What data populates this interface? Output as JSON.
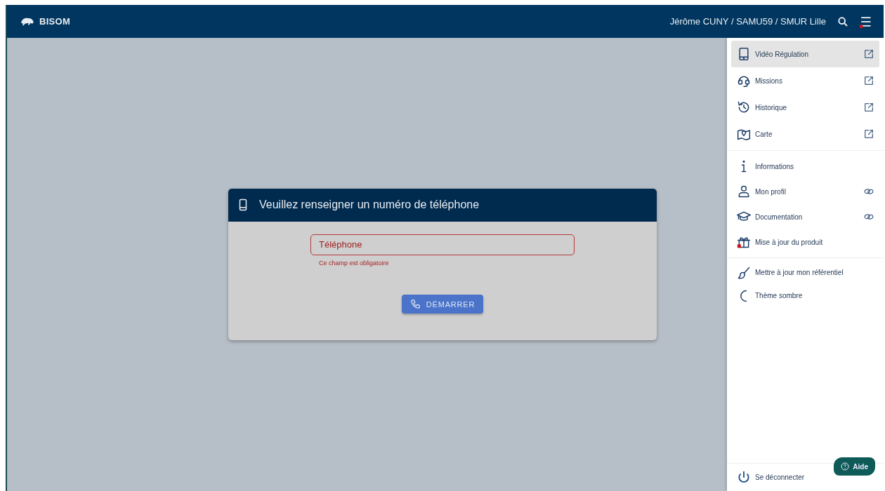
{
  "header": {
    "brand": "BISOM",
    "user": "Jérôme CUNY / SAMU59 / SMUR Lille",
    "menu_notification": true
  },
  "dialog": {
    "title": "Veuillez renseigner un numéro de téléphone",
    "field": {
      "placeholder": "Téléphone",
      "invalid": true,
      "error": "Ce champ est obligatoire"
    },
    "start_button": {
      "label": "DÉMARRER"
    }
  },
  "menu": {
    "groups": [
      {
        "items": [
          {
            "label": "Vidéo Régulation",
            "kind": "external",
            "selected": true,
            "notification": false
          },
          {
            "label": "Missions",
            "kind": "external",
            "selected": false,
            "notification": false
          },
          {
            "label": "Historique",
            "kind": "external",
            "selected": false,
            "notification": false
          },
          {
            "label": "Carte",
            "kind": "external",
            "selected": false,
            "notification": false
          }
        ]
      },
      {
        "items": [
          {
            "label": "Informations",
            "kind": "plain",
            "selected": false,
            "notification": false
          },
          {
            "label": "Mon profil",
            "kind": "link",
            "selected": false,
            "notification": false
          },
          {
            "label": "Documentation",
            "kind": "link",
            "selected": false,
            "notification": false
          },
          {
            "label": "Mise à jour du produit",
            "kind": "plain",
            "selected": false,
            "notification": true
          }
        ]
      },
      {
        "items": [
          {
            "label": "Mettre à jour mon référentiel",
            "kind": "plain",
            "selected": false,
            "notification": false
          },
          {
            "label": "Thème sombre",
            "kind": "plain",
            "selected": false,
            "notification": false
          }
        ]
      }
    ],
    "logout": {
      "label": "Se déconnecter"
    }
  },
  "help_button": {
    "label": "Aide"
  }
}
